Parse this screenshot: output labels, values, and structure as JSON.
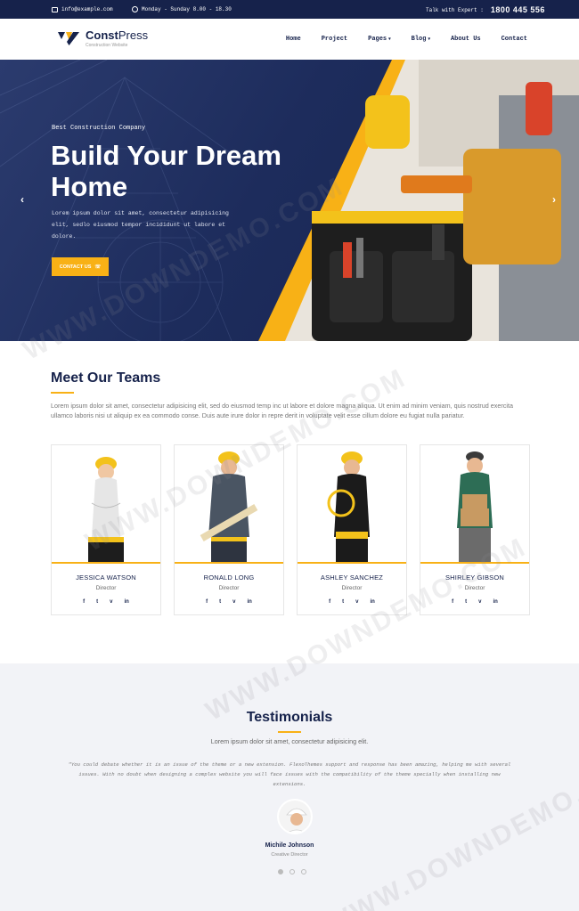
{
  "topbar": {
    "email": "info@example.com",
    "hours": "Monday - Sunday 8.00 - 18.30",
    "talk_label": "Talk with Expert :",
    "phone": "1800 445 556"
  },
  "header": {
    "brand_bold": "Const",
    "brand_light": "Press",
    "tagline": "Construction Website",
    "nav": [
      {
        "label": "Home",
        "caret": false
      },
      {
        "label": "Project",
        "caret": false
      },
      {
        "label": "Pages",
        "caret": true
      },
      {
        "label": "Blog",
        "caret": true
      },
      {
        "label": "About Us",
        "caret": false
      },
      {
        "label": "Contact",
        "caret": false
      }
    ]
  },
  "hero": {
    "eyebrow": "Best Construction Company",
    "title": "Build Your Dream Home",
    "lead": "Lorem ipsum dolor sit amet, consectetur adipisicing elit, sedlo eiusmod tempor incididunt ut labore et dolore.",
    "cta": "CONTACT US",
    "prev": "‹",
    "next": "›"
  },
  "teams": {
    "title": "Meet Our Teams",
    "description": "Lorem ipsum dolor sit amet, consectetur adipisicing elit, sed do eiusmod temp inc ut labore et dolore magna aliqua. Ut enim ad minim veniam, quis nostrud exercita ullamco laboris nisi ut aliquip ex ea commodo conse. Duis aute irure dolor in repre derit in voluptate velit esse cillum dolore eu fugiat nulla pariatur.",
    "members": [
      {
        "name": "JESSICA WATSON",
        "role": "Director"
      },
      {
        "name": "RONALD LONG",
        "role": "Director"
      },
      {
        "name": "ASHLEY SANCHEZ",
        "role": "Director"
      },
      {
        "name": "SHIRLEY GIBSON",
        "role": "Director"
      }
    ],
    "social": [
      "f",
      "t",
      "v",
      "in"
    ]
  },
  "testimonials": {
    "title": "Testimonials",
    "subtitle": "Lorem ipsum dolor sit amet, consectetur adipisicing elit.",
    "quote": "\"You could debate whether it is an issue of the theme or a new extension. FlexoThemes support and response has been amazing, helping me with several issues. With no doubt when designing a complex website you will face issues with the compatibility of the theme specially when installing new extensions.",
    "person": "Michile Johnson",
    "person_title": "Creative Director"
  },
  "colors": {
    "navy": "#16224b",
    "accent": "#f8b116"
  },
  "watermark": "WWW.DOWNDEMO.COM"
}
